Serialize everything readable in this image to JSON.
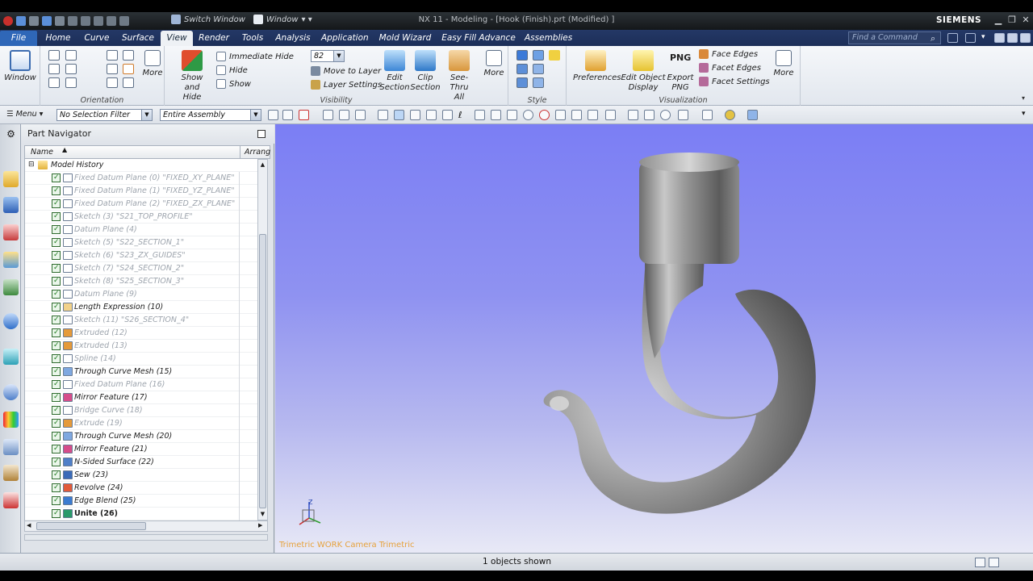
{
  "titlebar": {
    "switch_window": "Switch Window",
    "window_menu": "Window",
    "title": "NX 11 - Modeling - [Hook (Finish).prt (Modified) ]",
    "brand": "SIEMENS"
  },
  "tabs": [
    "File",
    "Home",
    "Curve",
    "Surface",
    "View",
    "Render",
    "Tools",
    "Analysis",
    "Application",
    "Mold Wizard",
    "Easy Fill Advance",
    "Assemblies"
  ],
  "active_tab": "View",
  "find_command": {
    "placeholder": "Find a Command"
  },
  "ribbon": {
    "window": {
      "label": "Window"
    },
    "orientation": {
      "group": "Orientation",
      "more": "More"
    },
    "visibility": {
      "group": "Visibility",
      "show_and_hide": [
        "Show",
        "and Hide"
      ],
      "immediate_hide": "Immediate Hide",
      "hide": "Hide",
      "show": "Show",
      "layer_value": "82",
      "move_to_layer": "Move to Layer",
      "layer_settings": "Layer Settings",
      "edit_section": [
        "Edit",
        "Section"
      ],
      "clip_section": [
        "Clip",
        "Section"
      ],
      "see_thru_all": [
        "See-Thru",
        "All"
      ],
      "more": "More"
    },
    "style": {
      "group": "Style"
    },
    "visualization": {
      "group": "Visualization",
      "preferences": "Preferences",
      "edit_object_display": [
        "Edit Object",
        "Display"
      ],
      "export_png": [
        "Export",
        "PNG"
      ],
      "png_badge": "PNG",
      "face_edges": "Face Edges",
      "facet_edges": "Facet Edges",
      "facet_settings": "Facet Settings",
      "more": "More"
    }
  },
  "toolbar2": {
    "menu": "Menu",
    "selection_filter": "No Selection Filter",
    "scope": "Entire Assembly"
  },
  "navigator": {
    "title": "Part Navigator",
    "col_name": "Name",
    "col_arrange": "Arrang",
    "root": "Model History",
    "items": [
      {
        "label": "Fixed Datum Plane (0) \"FIXED_XY_PLANE\"",
        "icon": "datum-plane-icon",
        "dim": true
      },
      {
        "label": "Fixed Datum Plane (1) \"FIXED_YZ_PLANE\"",
        "icon": "datum-plane-icon",
        "dim": true
      },
      {
        "label": "Fixed Datum Plane (2) \"FIXED_ZX_PLANE\"",
        "icon": "datum-plane-icon",
        "dim": true
      },
      {
        "label": "Sketch (3) \"S21_TOP_PROFILE\"",
        "icon": "sketch-icon",
        "dim": true
      },
      {
        "label": "Datum Plane (4)",
        "icon": "datum-plane-icon",
        "dim": true
      },
      {
        "label": "Sketch (5) \"S22_SECTION_1\"",
        "icon": "sketch-icon",
        "dim": true
      },
      {
        "label": "Sketch (6) \"S23_ZX_GUIDES\"",
        "icon": "sketch-icon",
        "dim": true
      },
      {
        "label": "Sketch (7) \"S24_SECTION_2\"",
        "icon": "sketch-icon",
        "dim": true
      },
      {
        "label": "Sketch (8) \"S25_SECTION_3\"",
        "icon": "sketch-icon",
        "dim": true
      },
      {
        "label": "Datum Plane (9)",
        "icon": "datum-plane-icon",
        "dim": true
      },
      {
        "label": "Length Expression (10)",
        "icon": "expression-icon",
        "dim": false
      },
      {
        "label": "Sketch (11) \"S26_SECTION_4\"",
        "icon": "sketch-icon",
        "dim": true
      },
      {
        "label": "Extruded (12)",
        "icon": "extrude-icon",
        "dim": true
      },
      {
        "label": "Extruded (13)",
        "icon": "extrude-icon",
        "dim": true
      },
      {
        "label": "Spline (14)",
        "icon": "spline-icon",
        "dim": true
      },
      {
        "label": "Through Curve Mesh (15)",
        "icon": "mesh-surface-icon",
        "dim": false
      },
      {
        "label": "Fixed Datum Plane (16)",
        "icon": "datum-plane-icon",
        "dim": true
      },
      {
        "label": "Mirror Feature (17)",
        "icon": "mirror-icon",
        "dim": false
      },
      {
        "label": "Bridge Curve (18)",
        "icon": "bridge-curve-icon",
        "dim": true
      },
      {
        "label": "Extrude (19)",
        "icon": "extrude-icon",
        "dim": true
      },
      {
        "label": "Through Curve Mesh (20)",
        "icon": "mesh-surface-icon",
        "dim": false
      },
      {
        "label": "Mirror Feature (21)",
        "icon": "mirror-icon",
        "dim": false
      },
      {
        "label": "N-Sided Surface (22)",
        "icon": "n-sided-surface-icon",
        "dim": false
      },
      {
        "label": "Sew (23)",
        "icon": "sew-icon",
        "dim": false
      },
      {
        "label": "Revolve (24)",
        "icon": "revolve-icon",
        "dim": false
      },
      {
        "label": "Edge Blend (25)",
        "icon": "edge-blend-icon",
        "dim": false
      },
      {
        "label": "Unite (26)",
        "icon": "unite-icon",
        "dim": false,
        "bold": true
      }
    ]
  },
  "viewport": {
    "camera_label": "Trimetric WORK Camera Trimetric",
    "triad_z": "Z"
  },
  "status": {
    "message": "1 objects shown"
  },
  "colors": {
    "tab_bar": "#1c2e58",
    "viewport_top": "#7b7ef4",
    "viewport_bottom": "#e8e9f6",
    "camera_label": "#e6a23c"
  }
}
